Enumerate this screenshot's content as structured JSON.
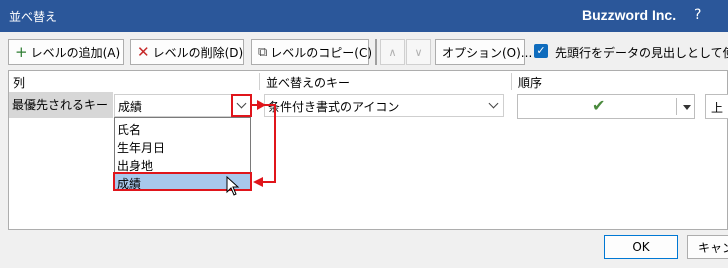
{
  "window": {
    "title": "並べ替え",
    "brand": "Buzzword Inc.",
    "help": "?"
  },
  "toolbar": {
    "add_level": "レベルの追加(A)",
    "delete_level": "レベルの削除(D)",
    "copy_level": "レベルのコピー(C)",
    "move_up": "∧",
    "move_down": "∨",
    "options": "オプション(O)...",
    "header_checkbox_label": "先頭行をデータの見出しとして使用す",
    "header_checkbox_checked": true
  },
  "columns": {
    "column": "列",
    "sort_on": "並べ替えのキー",
    "order": "順序"
  },
  "rows": [
    {
      "label": "最優先されるキー",
      "column_value": "成績",
      "sort_on_value": "条件付き書式のアイコン",
      "order_icon": "green-checkmark-icon",
      "order_value": "上"
    }
  ],
  "dropdown": {
    "options": [
      "氏名",
      "生年月日",
      "出身地",
      "成績"
    ],
    "selected": "成績"
  },
  "buttons": {
    "ok": "OK",
    "cancel": "キャンセル"
  },
  "colors": {
    "titlebar": "#2b579a",
    "annotation": "#e0151b",
    "selection": "#a8c8ec",
    "checkbox": "#0f6cbd"
  }
}
